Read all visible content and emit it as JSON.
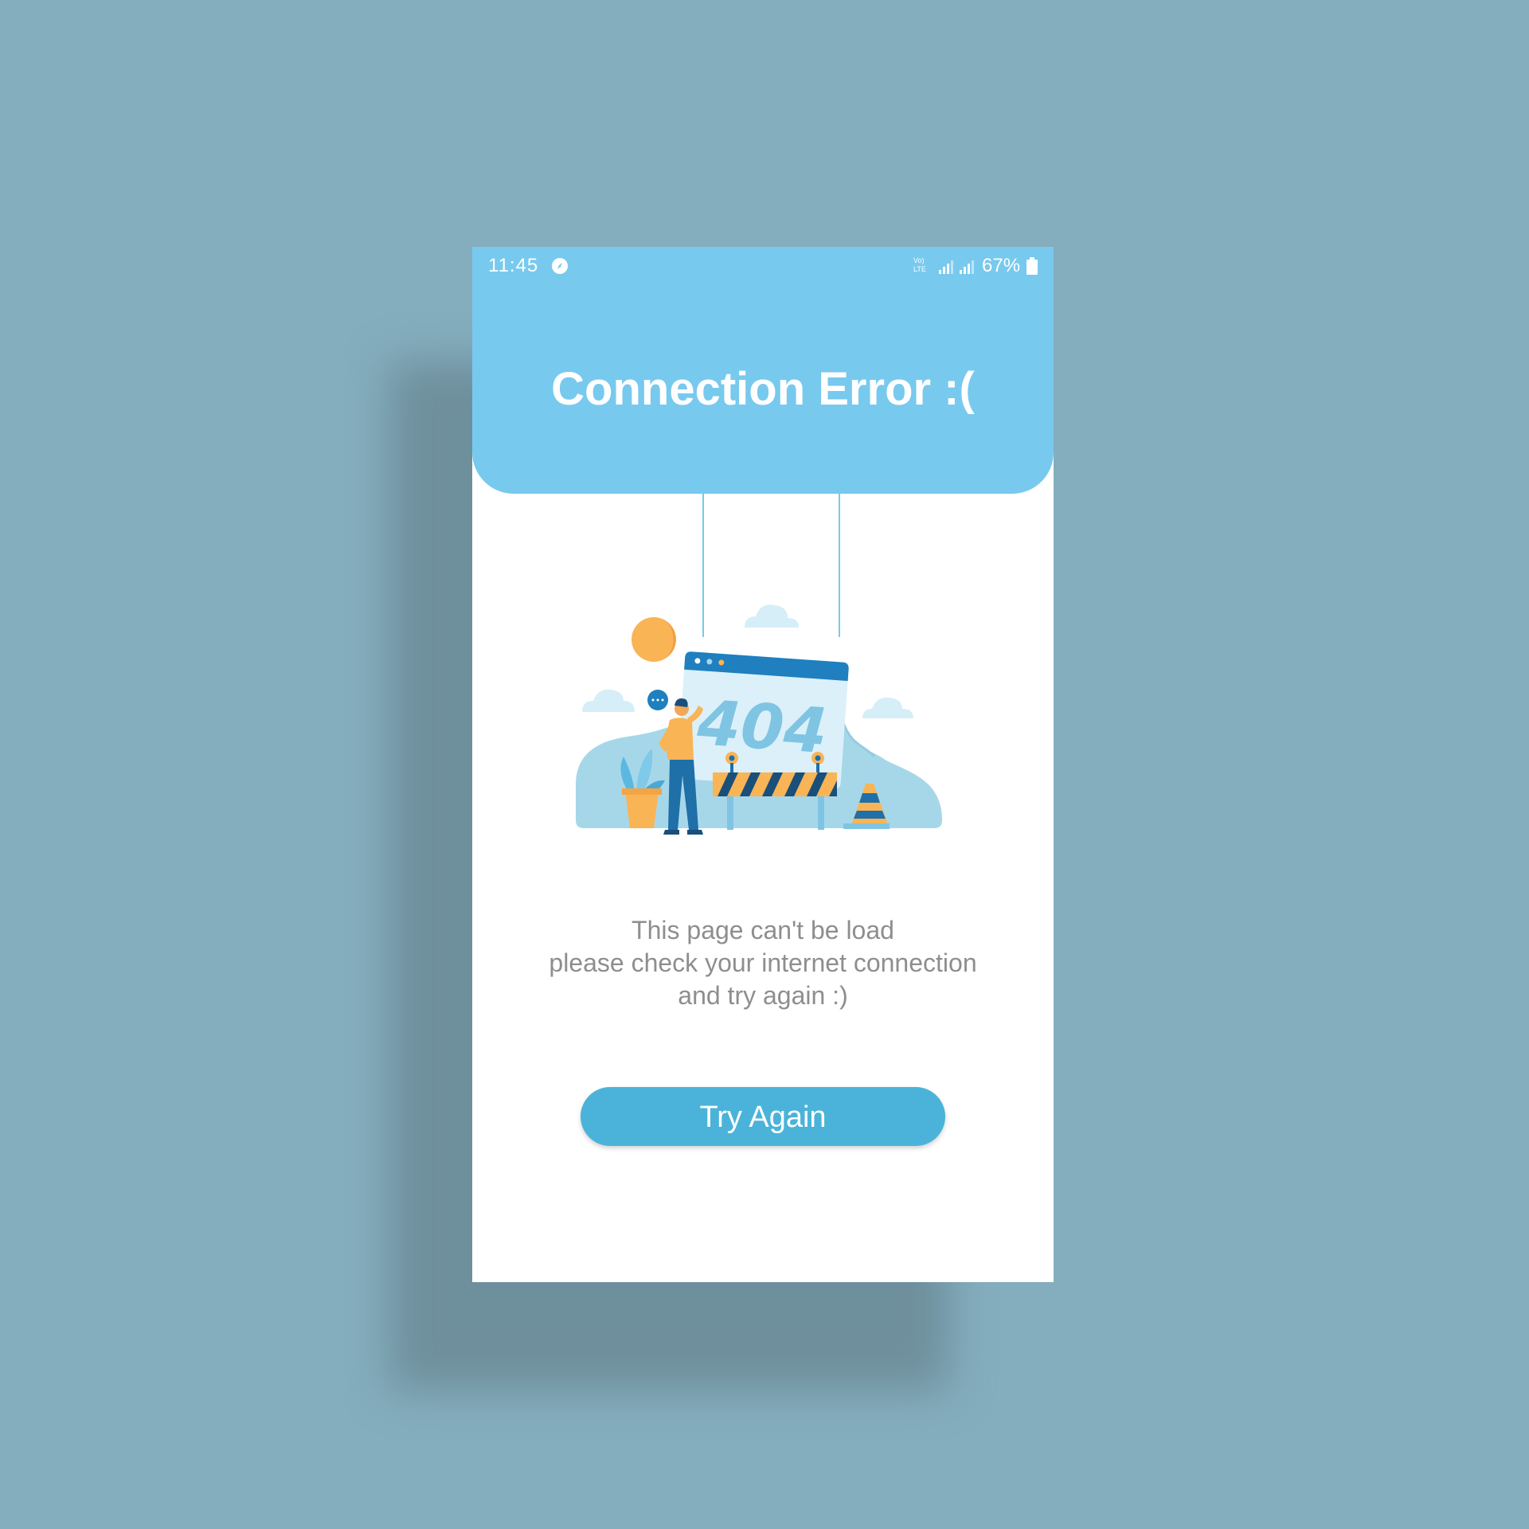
{
  "status_bar": {
    "time": "11:45",
    "network_label": "Vo) LTE",
    "battery": "67%"
  },
  "header": {
    "title": "Connection Error :("
  },
  "illustration": {
    "error_code": "404",
    "icons": [
      "sun-icon",
      "cloud-icon",
      "browser-window-icon",
      "person-icon",
      "plant-icon",
      "barrier-icon",
      "traffic-cone-icon"
    ]
  },
  "message": {
    "lines": [
      "This page can't be load",
      "please check your internet connection",
      "and try again :)"
    ]
  },
  "button": {
    "label": "Try Again"
  },
  "colors": {
    "background": "#84adbd",
    "header": "#78c9ee",
    "button": "#4bb3d9",
    "text_gray": "#8e8e8e"
  }
}
